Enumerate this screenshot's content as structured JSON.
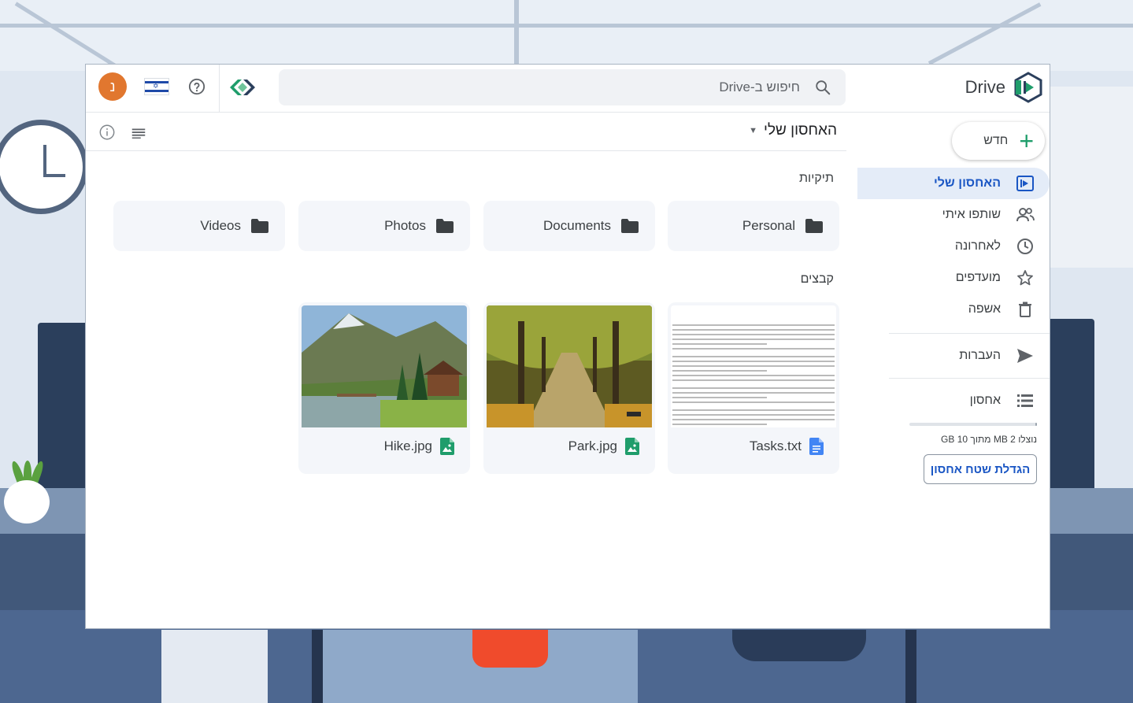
{
  "colors": {
    "accent": "#1a56c4",
    "brand_green": "#1f9d6b",
    "avatar_bg": "#e1772f",
    "active_nav_bg": "#e4ecf8"
  },
  "header": {
    "brand_name": "Drive",
    "search_placeholder": "חיפוש ב-Drive",
    "avatar_letter": "נ",
    "icons": [
      "drive-logo-icon",
      "search-icon",
      "app-switcher-icon",
      "help-icon",
      "israel-flag-icon"
    ]
  },
  "sidebar": {
    "new_label": "חדש",
    "items": [
      {
        "label": "האחסון שלי",
        "icon": "drive-folder-icon",
        "active": true
      },
      {
        "label": "שותפו איתי",
        "icon": "people-icon",
        "active": false
      },
      {
        "label": "לאחרונה",
        "icon": "clock-icon",
        "active": false
      },
      {
        "label": "מועדפים",
        "icon": "star-icon",
        "active": false
      },
      {
        "label": "אשפה",
        "icon": "trash-icon",
        "active": false
      }
    ],
    "transfers_label": "העברות",
    "storage_label": "אחסון",
    "storage_usage": "נוצלו 2 MB מתוך 10 GB",
    "storage_used_fraction": 0.0002,
    "upgrade_label": "הגדלת שטח אחסון"
  },
  "main": {
    "breadcrumb": "האחסון שלי",
    "folders_title": "תיקיות",
    "files_title": "קבצים",
    "folders": [
      {
        "name": "Personal"
      },
      {
        "name": "Documents"
      },
      {
        "name": "Photos"
      },
      {
        "name": "Videos"
      }
    ],
    "files": [
      {
        "name": "Tasks.txt",
        "type": "doc"
      },
      {
        "name": "Park.jpg",
        "type": "image"
      },
      {
        "name": "Hike.jpg",
        "type": "image"
      }
    ]
  }
}
